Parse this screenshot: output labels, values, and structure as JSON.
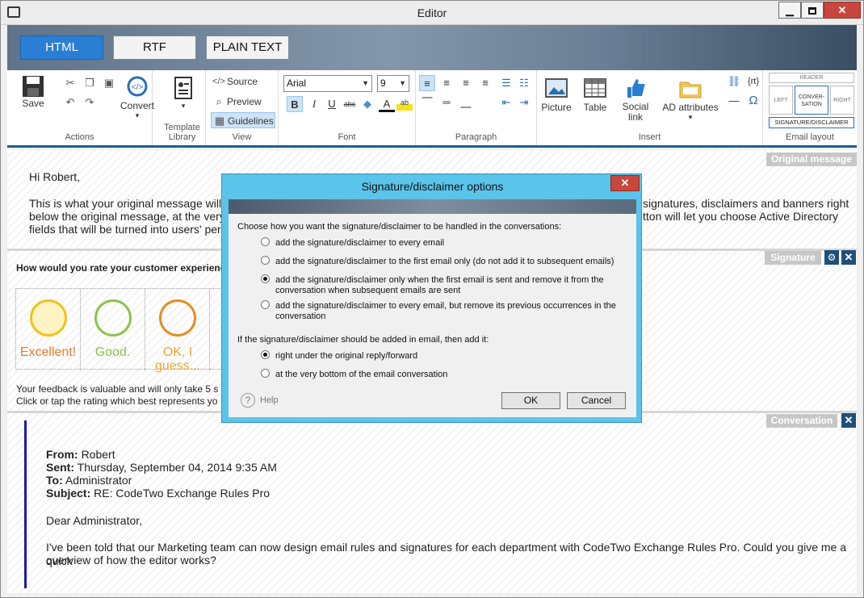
{
  "window": {
    "title": "Editor",
    "min_glyph": "▁",
    "max_glyph": "",
    "close_glyph": "✕"
  },
  "modes": [
    {
      "label": "HTML",
      "active": true
    },
    {
      "label": "RTF",
      "active": false
    },
    {
      "label": "PLAIN TEXT",
      "active": false
    }
  ],
  "ribbon": {
    "actions": {
      "save": "Save",
      "convert": "Convert",
      "convert_arrow": "▾",
      "label": "Actions"
    },
    "template": {
      "label": "Template Library",
      "arrow": "▾"
    },
    "view": {
      "source": "Source",
      "preview": "Preview",
      "guidelines": "Guidelines",
      "label": "View"
    },
    "font": {
      "name": "Arial",
      "size": "9",
      "label": "Font",
      "bold": "B",
      "italic": "I",
      "underline": "U",
      "strike": "abc",
      "color_a": "A",
      "highlight": "ab"
    },
    "paragraph": {
      "label": "Paragraph"
    },
    "insert": {
      "picture": "Picture",
      "table": "Table",
      "social": "Social link",
      "ad": "AD attributes",
      "ad_arrow": "▾",
      "label": "Insert",
      "rt": "{rt}",
      "omega": "Ω"
    },
    "layout": {
      "header": "HEADER",
      "left": "LEFT",
      "conversation": "CONVER-SATION",
      "right": "RIGHT",
      "sig": "SIGNATURE/DISCLAIMER",
      "label": "Email layout"
    }
  },
  "content": {
    "original_tag": "Original message",
    "signature_tag": "Signature",
    "conversation_tag": "Conversation",
    "hi": "Hi Robert,",
    "para1_left": "This is what your original message will loo",
    "para1_right": "signatures, disclaimers and banners right",
    "para2_left": "below the original message, at the very be",
    "para2_right": "tton will let you choose Active Directory",
    "para3_left": "fields that will be turned into users' perso",
    "rate_question": "How would you rate your customer experienc",
    "ratings": [
      {
        "label": "Excellent!",
        "color": "#e87c2a",
        "face": "#f1c21b"
      },
      {
        "label": "Good.",
        "color": "#8bc34a",
        "face": "#8bc34a"
      },
      {
        "label": "OK, I guess...",
        "color": "#f0a52a",
        "face": "#e58d1f"
      }
    ],
    "feedback1": "Your feedback is valuable and will only take 5 s",
    "feedback2": "Click or tap the rating which best represents yo",
    "from_label": "From:",
    "from": "Robert",
    "sent_label": "Sent:",
    "sent": "Thursday, September 04, 2014 9:35 AM",
    "to_label": "To:",
    "to": "Administrator",
    "subject_label": "Subject:",
    "subject": "RE: CodeTwo Exchange Rules Pro",
    "dear": "Dear Administrator,",
    "body1": "I've been told that our Marketing team can now design email rules and signatures for each department with CodeTwo Exchange Rules Pro. Could you give me a quick",
    "body2": "overview of how the editor works?"
  },
  "dialog": {
    "title": "Signature/disclaimer options",
    "close": "✕",
    "q1": "Choose how you want the signature/disclaimer to be handled in the conversations:",
    "opt1": "add the signature/disclaimer to every email",
    "opt2": "add the signature/disclaimer to the first email only (do not add it to subsequent emails)",
    "opt3a": "add the signature/disclaimer only when the first email is sent and remove it from the",
    "opt3b": "conversation when subsequent emails are sent",
    "opt4a": "add the signature/disclaimer to every email, but remove its previous occurrences in the",
    "opt4b": "conversation",
    "q2": "If the signature/disclaimer should be added in email, then add it:",
    "opt5": "right under the original reply/forward",
    "opt6": "at the very bottom of the email conversation",
    "help": "Help",
    "help_icon": "?",
    "ok": "OK",
    "cancel": "Cancel"
  }
}
